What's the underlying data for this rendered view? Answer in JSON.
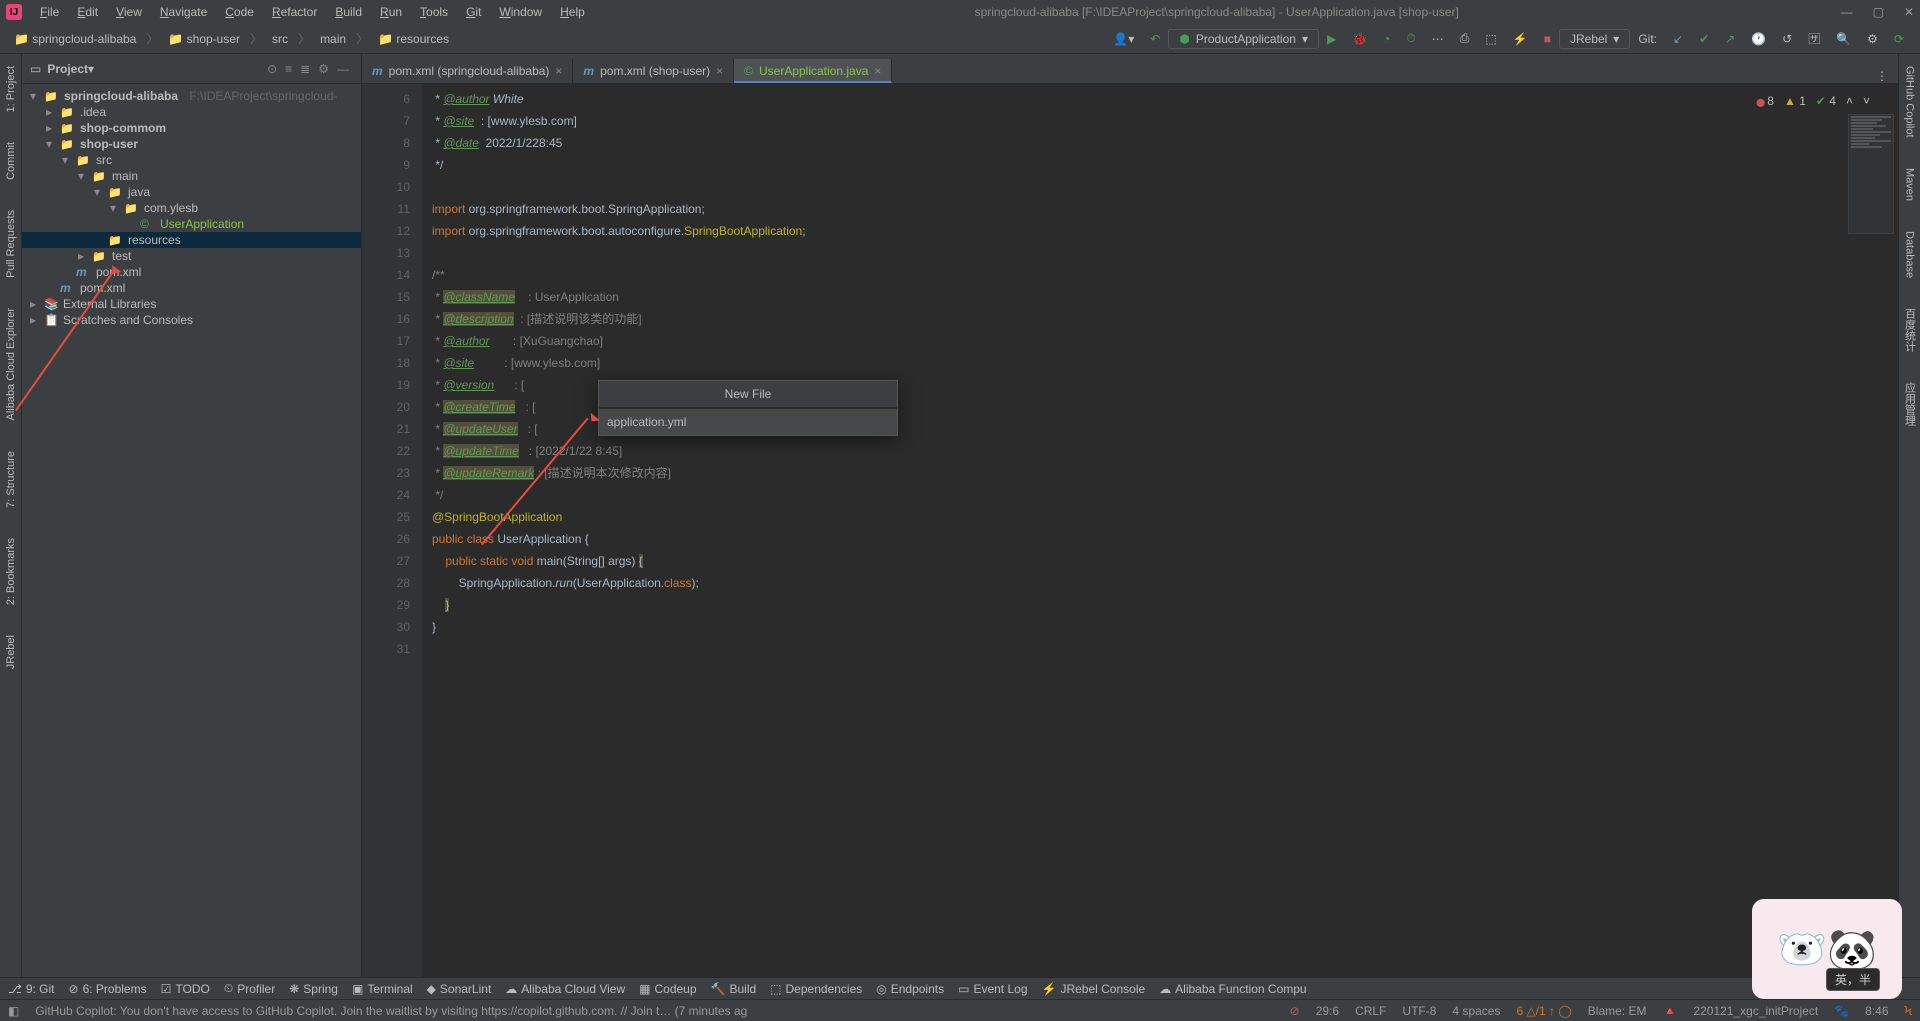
{
  "title": "springcloud-alibaba [F:\\IDEAProject\\springcloud-alibaba] - UserApplication.java [shop-user]",
  "menus": [
    "File",
    "Edit",
    "View",
    "Navigate",
    "Code",
    "Refactor",
    "Build",
    "Run",
    "Tools",
    "Git",
    "Window",
    "Help"
  ],
  "breadcrumb": [
    "springcloud-alibaba",
    "shop-user",
    "src",
    "main",
    "resources"
  ],
  "runconfig": "ProductApplication",
  "jrebel_label": "JRebel",
  "git_label": "Git:",
  "project_label": "Project",
  "tree": {
    "root": "springcloud-alibaba",
    "root_path": "F:\\IDEAProject\\springcloud-",
    "idea": ".idea",
    "commom": "shop-commom",
    "user": "shop-user",
    "src": "src",
    "main": "main",
    "java": "java",
    "pkg": "com.ylesb",
    "cls": "UserApplication",
    "resources": "resources",
    "test": "test",
    "pom1": "pom.xml",
    "pom2": "pom.xml",
    "extlib": "External Libraries",
    "scratch": "Scratches and Consoles"
  },
  "tabs": [
    {
      "label": "pom.xml (springcloud-alibaba)",
      "icon": "mvn",
      "active": false
    },
    {
      "label": "pom.xml (shop-user)",
      "icon": "mvn",
      "active": false
    },
    {
      "label": "UserApplication.java",
      "icon": "jcls",
      "active": true
    }
  ],
  "insp": {
    "err": "8",
    "warn": "1",
    "ok": "4"
  },
  "lines_start": 6,
  "code": [
    {
      "n": 6,
      "html": " * <span class='c-tag'>@author</span> <span class='c-it'>White</span>"
    },
    {
      "n": 7,
      "html": " * <span class='c-tag'>@site</span>  : [www.ylesb.com]"
    },
    {
      "n": 8,
      "html": " * <span class='c-tag'>@date</span>  2022/1/228:45"
    },
    {
      "n": 9,
      "html": " */"
    },
    {
      "n": 10,
      "html": ""
    },
    {
      "n": 11,
      "html": "<span class='c-kw'>import</span> org.springframework.boot.SpringApplication;"
    },
    {
      "n": 12,
      "html": "<span class='c-kw'>import</span> org.springframework.boot.autoconfigure.<span class='c-ann'>SpringBootApplication</span>;"
    },
    {
      "n": 13,
      "html": ""
    },
    {
      "n": 14,
      "html": "<span class='c-cmt'>/**</span>"
    },
    {
      "n": 15,
      "html": "<span class='c-cmt'> * </span><span class='c-tag c-em'>@className</span><span class='c-cmt'>    : UserApplication</span>"
    },
    {
      "n": 16,
      "html": "<span class='c-cmt'> * </span><span class='c-tag c-em'>@description</span><span class='c-cmt'>  : [描述说明该类的功能]</span>"
    },
    {
      "n": 17,
      "html": "<span class='c-cmt'> * </span><span class='c-tag'>@author</span><span class='c-cmt'>       : [XuGuangchao]</span>"
    },
    {
      "n": 18,
      "html": "<span class='c-cmt'> * </span><span class='c-tag'>@site</span><span class='c-cmt'>         : [www.ylesb.com]</span>"
    },
    {
      "n": 19,
      "html": "<span class='c-cmt'> * </span><span class='c-tag'>@version</span><span class='c-cmt'>      : [</span>"
    },
    {
      "n": 20,
      "html": "<span class='c-cmt'> * </span><span class='c-tag c-em'>@createTime</span><span class='c-cmt'>   : [</span>"
    },
    {
      "n": 21,
      "html": "<span class='c-cmt'> * </span><span class='c-tag c-em'>@updateUser</span><span class='c-cmt'>   : [</span>"
    },
    {
      "n": 22,
      "html": "<span class='c-cmt'> * </span><span class='c-tag c-em'>@updateTime</span><span class='c-cmt'>   : [2022/1/22 8:45]</span>"
    },
    {
      "n": 23,
      "html": "<span class='c-cmt'> * </span><span class='c-tag c-em'>@updateRemark</span><span class='c-cmt'> : [描述说明本次修改内容]</span>"
    },
    {
      "n": 24,
      "html": "<span class='c-cmt'> */</span>"
    },
    {
      "n": 25,
      "html": "<span class='c-ann'>@SpringBootApplication</span>"
    },
    {
      "n": 26,
      "html": "<span class='c-kw'>public class</span> UserApplication {"
    },
    {
      "n": 27,
      "html": "    <span class='c-kw'>public static void</span> main(String[] args) <span class='c-em'>{</span>"
    },
    {
      "n": 28,
      "html": "        SpringApplication.<span class='c-it'>run</span>(UserApplication.<span class='c-kw'>class</span>);"
    },
    {
      "n": 29,
      "html": "    <span class='c-em'>}</span>"
    },
    {
      "n": 30,
      "html": "}"
    },
    {
      "n": 31,
      "html": ""
    }
  ],
  "dialog": {
    "title": "New File",
    "value": "application.yml"
  },
  "left_tabs": [
    "1: Project",
    "Commit",
    "Pull Requests",
    "Alibaba Cloud Explorer",
    "7: Structure",
    "2: Bookmarks",
    "JRebel"
  ],
  "right_tabs": [
    "GitHub Copilot",
    "Maven",
    "Database",
    "百度统计",
    "应用管理"
  ],
  "bottom_tabs": [
    "9: Git",
    "6: Problems",
    "TODO",
    "Profiler",
    "Spring",
    "Terminal",
    "SonarLint",
    "Alibaba Cloud View",
    "Codeup",
    "Build",
    "Dependencies",
    "Endpoints",
    "Event Log",
    "JRebel Console",
    "Alibaba Function Compu"
  ],
  "status": {
    "msg": "GitHub Copilot: You don't have access to GitHub Copilot. Join the waitlist by visiting https://copilot.github.com. // Join t… (7 minutes ag",
    "pos": "29:6",
    "eol": "CRLF",
    "enc": "UTF-8",
    "indent": "4 spaces",
    "inspect": "6 △/1 ↑ ◯",
    "blame": "Blame: EM",
    "branch": "220121_xgc_initProject",
    "time": "8:46"
  },
  "ime": "英，半"
}
